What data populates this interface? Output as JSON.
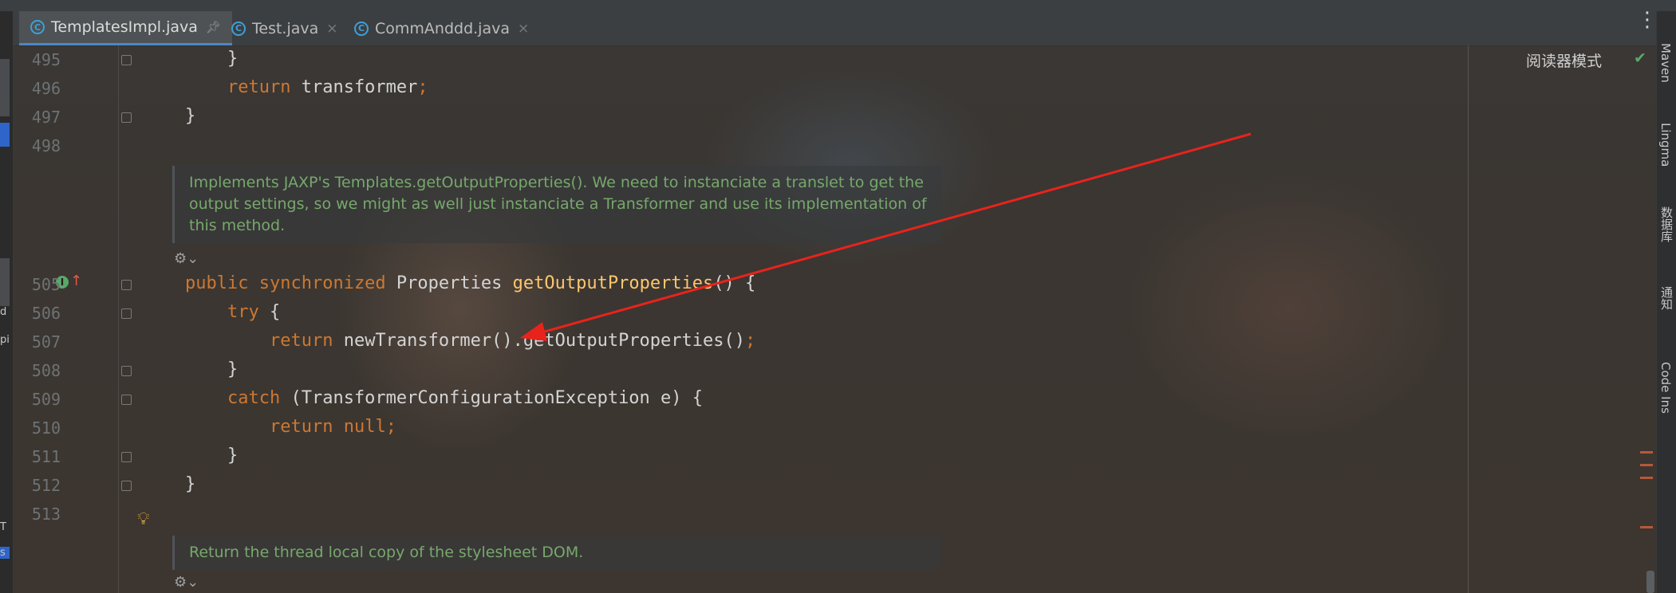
{
  "tabs": [
    {
      "label": "TemplatesImpl.java",
      "active": true,
      "pinned": true
    },
    {
      "label": "Test.java",
      "active": false
    },
    {
      "label": "CommAnddd.java",
      "active": false
    }
  ],
  "reader_mode": "阅读器模式",
  "right_toolbar": [
    "Maven",
    "Lingma",
    "数据库",
    "通知",
    "Code Ins"
  ],
  "left_strip_text": [
    "d",
    "pi",
    "T",
    "s"
  ],
  "lines": [
    {
      "num": "495",
      "code": "    }"
    },
    {
      "num": "496",
      "code": "    return transformer;"
    },
    {
      "num": "497",
      "code": "}"
    },
    {
      "num": "498",
      "code": ""
    },
    {
      "num": "505",
      "code": "public synchronized Properties getOutputProperties() {"
    },
    {
      "num": "506",
      "code": "    try {"
    },
    {
      "num": "507",
      "code": "        return newTransformer().getOutputProperties();"
    },
    {
      "num": "508",
      "code": "    }"
    },
    {
      "num": "509",
      "code": "    catch (TransformerConfigurationException e) {"
    },
    {
      "num": "510",
      "code": "        return null;"
    },
    {
      "num": "511",
      "code": "    }"
    },
    {
      "num": "512",
      "code": "}"
    },
    {
      "num": "513",
      "code": ""
    }
  ],
  "docs": [
    "Implements JAXP's Templates.getOutputProperties(). We need to instanciate a translet to get the output settings, so we might as well just instanciate a Transformer and use its implementation of this method.",
    "Return the thread local copy of the stylesheet DOM."
  ],
  "colors": {
    "keyword": "#cc7832",
    "method": "#ffc66d",
    "doc": "#77a86b",
    "arrow": "#e8231c"
  }
}
